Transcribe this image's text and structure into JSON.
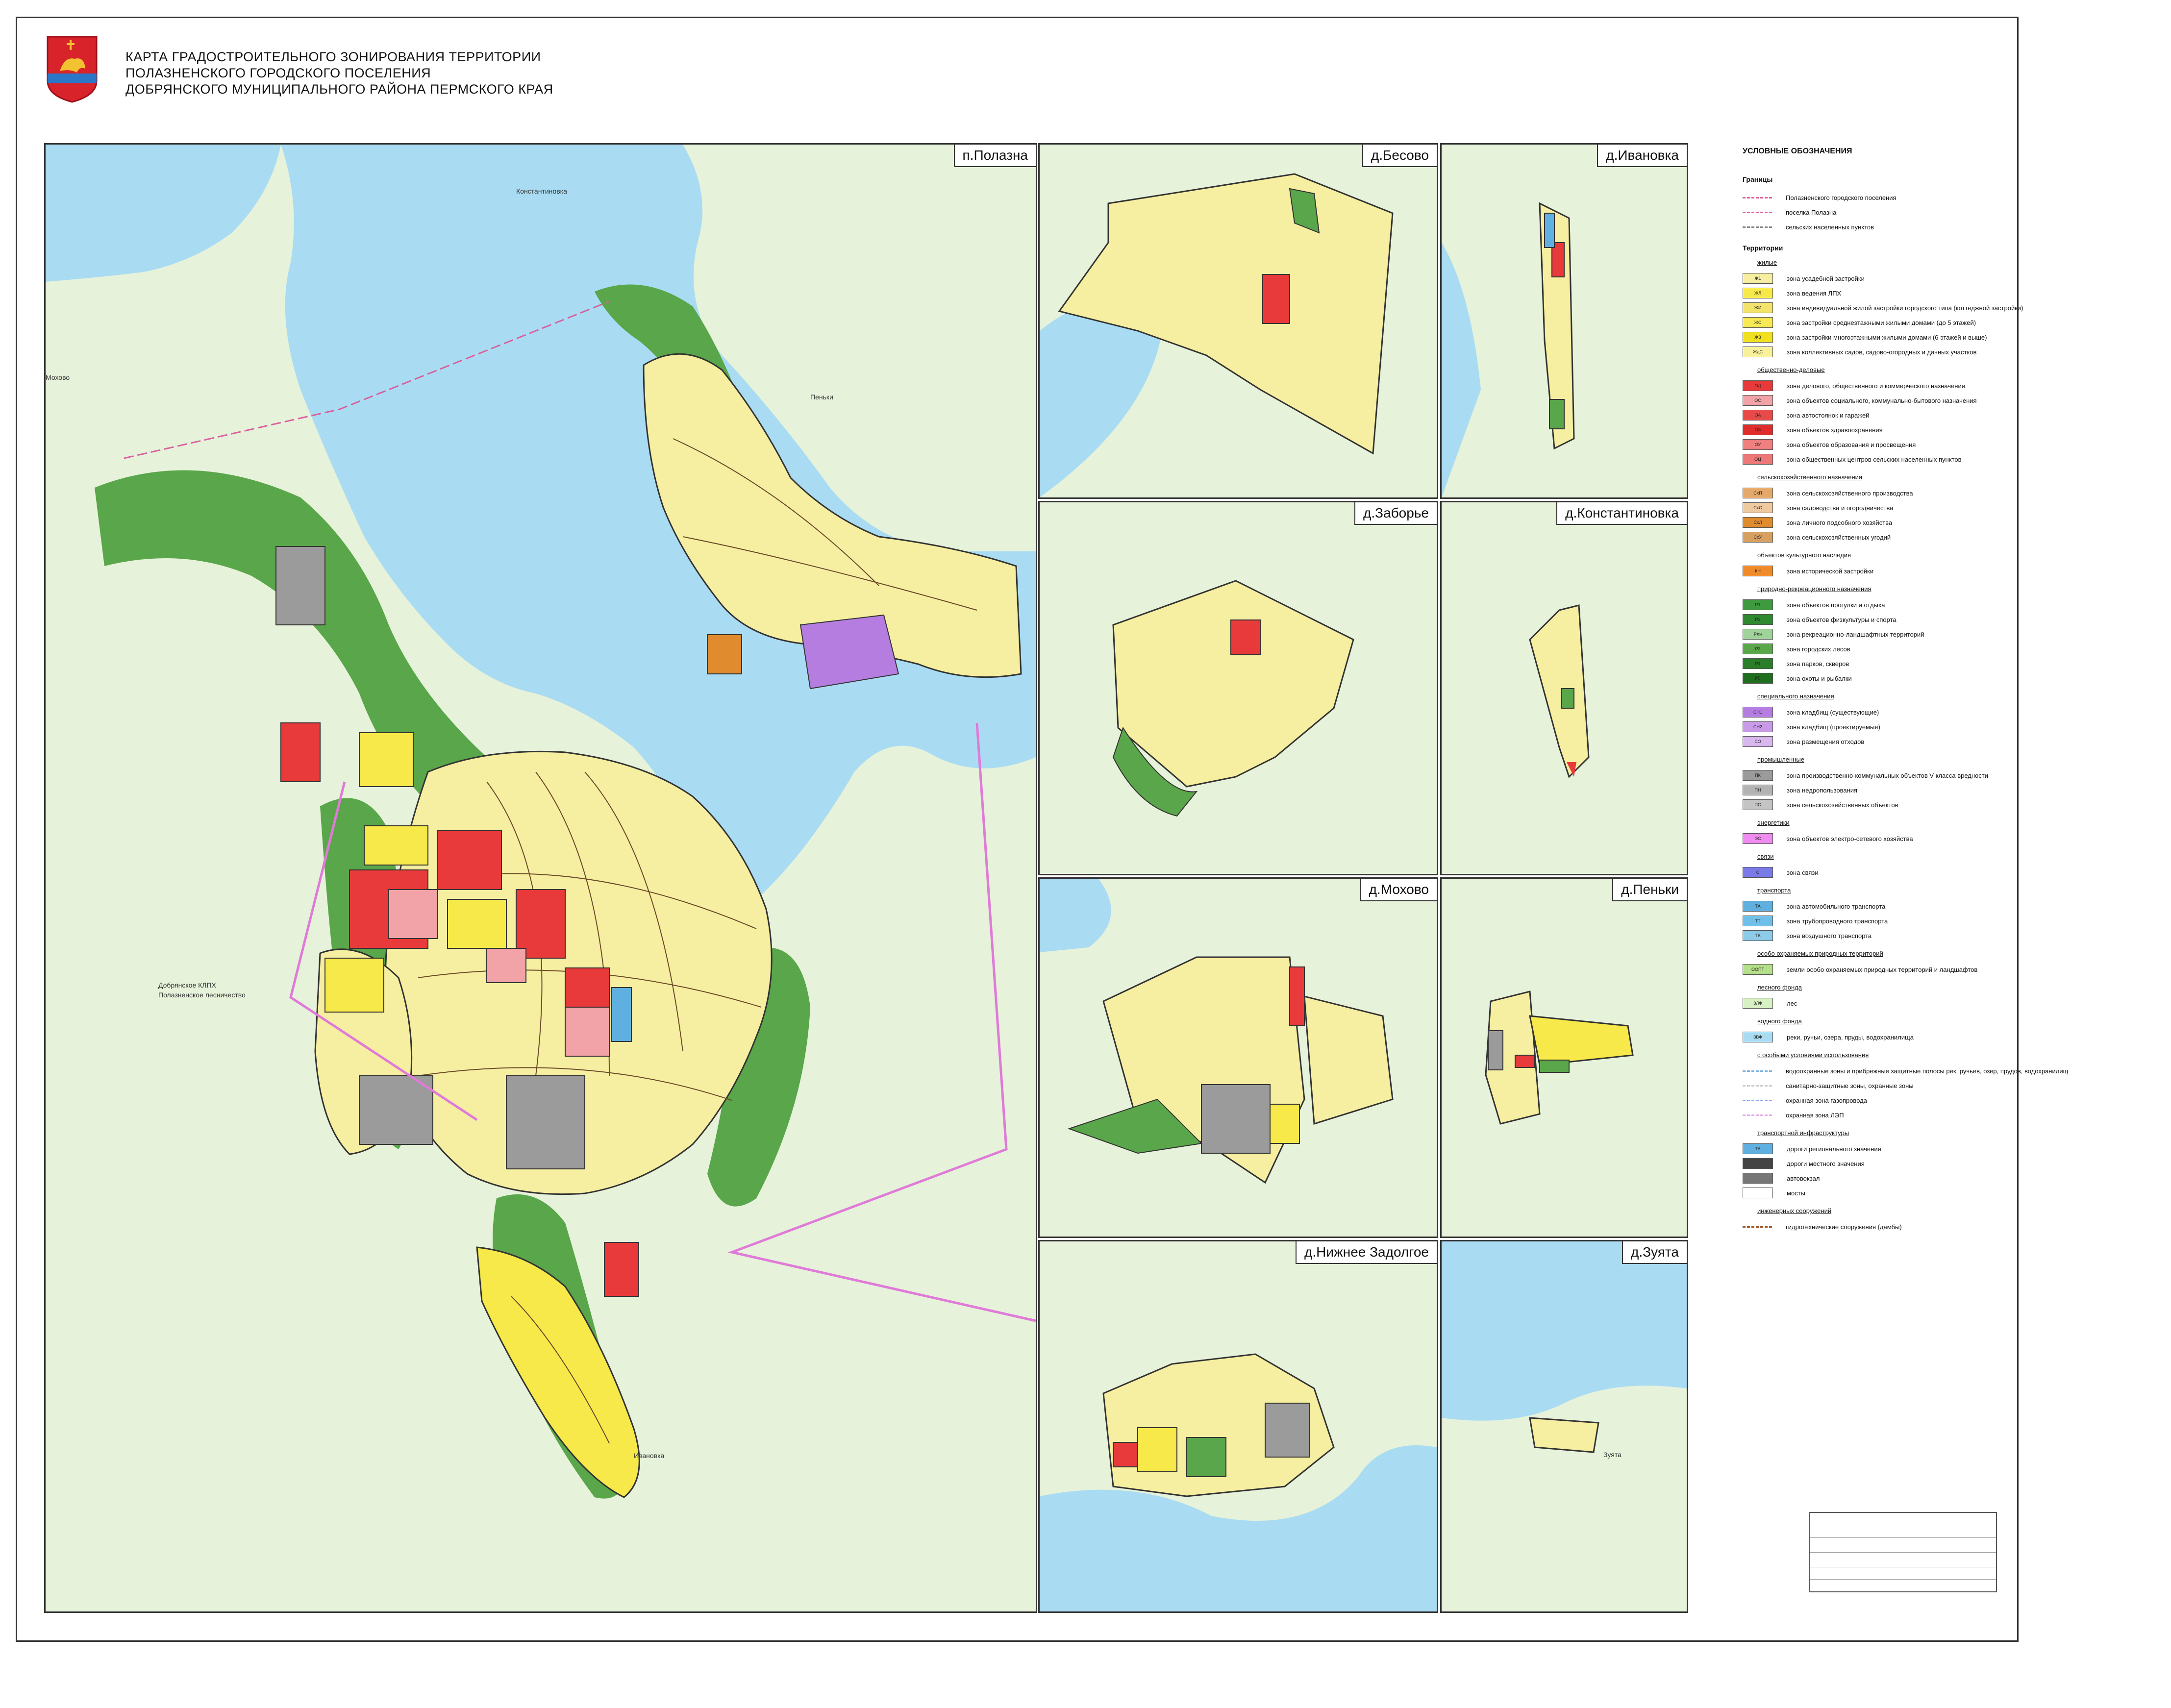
{
  "title": {
    "lines": [
      "КАРТА ГРАДОСТРОИТЕЛЬНОГО ЗОНИРОВАНИЯ ТЕРРИТОРИИ",
      "ПОЛАЗНЕНСКОГО ГОРОДСКОГО ПОСЕЛЕНИЯ",
      "ДОБРЯНСКОГО МУНИЦИПАЛЬНОГО РАЙОНА ПЕРМСКОГО КРАЯ"
    ]
  },
  "panels": {
    "polazna": "п.Полазна",
    "besovo": "д.Бесово",
    "ivanovka": "д.Ивановка",
    "zabore": "д.Заборье",
    "konstantinovka": "д.Константиновка",
    "mokhovo": "д.Мохово",
    "penki": "д.Пеньки",
    "nizhnee_zadolgoe": "д.Нижнее Задолгое",
    "zuyata": "д.Зуята"
  },
  "map_labels": {
    "konstantinovka": "Константиновка",
    "penki": "Пеньки",
    "ivanovka": "Ивановка",
    "mokhovo": "Мохово",
    "zuyata": "Зуята",
    "forestry1": "Добрянское КЛПХ",
    "forestry2": "Полазненское лесничество"
  },
  "colors": {
    "water": "#a9dcf2",
    "land": "#e8f3dc",
    "forest": "#5aa64a",
    "residential": "#f6eea0",
    "residential_lph": "#f7e94a",
    "business": "#e83a3a",
    "social": "#f2a3a8",
    "industrial": "#9b9b9b",
    "cemetery": "#b57de0",
    "transport": "#5fb0e0",
    "agri": "#e08c2e",
    "boundary": "#e07ad8"
  },
  "legend": {
    "title": "УСЛОВНЫЕ ОБОЗНАЧЕНИЯ",
    "boundaries_header": "Границы",
    "boundaries": [
      {
        "label": "Полазненского городского поселения",
        "color": "#d9609e"
      },
      {
        "label": "поселка Полазна",
        "color": "#d9609e"
      },
      {
        "label": "сельских населенных пунктов",
        "color": "#888888"
      }
    ],
    "territories_header": "Территории",
    "groups": [
      {
        "name": "жилые",
        "items": [
          {
            "code": "Ж1",
            "label": "зона усадебной застройки",
            "color": "#f6eea0"
          },
          {
            "code": "ЖЛ",
            "label": "зона ведения ЛПХ",
            "color": "#f7e94a"
          },
          {
            "code": "ЖИ",
            "label": "зона индивидуальной жилой застройки городского типа (коттеджной застройки)",
            "color": "#f3e36a"
          },
          {
            "code": "ЖС",
            "label": "зона застройки среднеэтажными жилыми домами (до 5 этажей)",
            "color": "#f7ea55"
          },
          {
            "code": "ЖЗ",
            "label": "зона застройки многоэтажными жилыми домами (6 этажей и выше)",
            "color": "#f1e01e"
          },
          {
            "code": "ЖдС",
            "label": "зона коллективных садов, садово-огородных и дачных участков",
            "color": "#f8f09a"
          }
        ]
      },
      {
        "name": "общественно-деловые",
        "items": [
          {
            "code": "ОД",
            "label": "зона делового, общественного и коммерческого назначения",
            "color": "#e83a3a"
          },
          {
            "code": "ОС",
            "label": "зона объектов социального, коммунально-бытового назначения",
            "color": "#f2a3a8"
          },
          {
            "code": "ОА",
            "label": "зона автостоянок и гаражей",
            "color": "#e84a4a"
          },
          {
            "code": "ОЗ",
            "label": "зона объектов здравоохранения",
            "color": "#e02c2c"
          },
          {
            "code": "ОУ",
            "label": "зона объектов образования и просвещения",
            "color": "#f08080"
          },
          {
            "code": "ОЦ",
            "label": "зона общественных центров сельских населенных пунктов",
            "color": "#ee7777"
          }
        ]
      },
      {
        "name": "сельскохозяйственного назначения",
        "items": [
          {
            "code": "СхП",
            "label": "зона сельскохозяйственного производства",
            "color": "#e3a86a"
          },
          {
            "code": "СхС",
            "label": "зона садоводства и огородничества",
            "color": "#efc9a0"
          },
          {
            "code": "СхЛ",
            "label": "зона личного подсобного хозяйства",
            "color": "#e08c2e"
          },
          {
            "code": "СхУ",
            "label": "зона сельскохозяйственных угодий",
            "color": "#d7a060"
          }
        ]
      },
      {
        "name": "объектов культурного наследия",
        "items": [
          {
            "code": "КН",
            "label": "зона исторической застройки",
            "color": "#ee8a2a"
          }
        ]
      },
      {
        "name": "природно-рекреационного назначения",
        "items": [
          {
            "code": "Р1",
            "label": "зона объектов прогулки и отдыха",
            "color": "#3f9a3f"
          },
          {
            "code": "Р2",
            "label": "зона объектов физкультуры и спорта",
            "color": "#2f8a2f"
          },
          {
            "code": "Рлн",
            "label": "зона рекреационно-ландшафтных территорий",
            "color": "#9fd39a"
          },
          {
            "code": "Р3",
            "label": "зона городских лесов",
            "color": "#5aa64a"
          },
          {
            "code": "Р4",
            "label": "зона парков, скверов",
            "color": "#2a7e2a"
          },
          {
            "code": "Р5",
            "label": "зона охоты и рыбалки",
            "color": "#1f6e1f"
          }
        ]
      },
      {
        "name": "специального назначения",
        "items": [
          {
            "code": "СН1",
            "label": "зона кладбищ (существующие)",
            "color": "#b57de0"
          },
          {
            "code": "СН2",
            "label": "зона кладбищ (проектируемые)",
            "color": "#c99ae8"
          },
          {
            "code": "СО",
            "label": "зона размещения отходов",
            "color": "#d9b8ef"
          }
        ]
      },
      {
        "name": "промышленные",
        "items": [
          {
            "code": "ПК",
            "label": "зона производственно-коммунальных объектов V класса вредности",
            "color": "#9b9b9b"
          },
          {
            "code": "ПН",
            "label": "зона недропользования",
            "color": "#b3b3b3"
          },
          {
            "code": "ПС",
            "label": "зона сельскохозяйственных объектов",
            "color": "#c4c4c4"
          }
        ]
      },
      {
        "name": "энергетики",
        "items": [
          {
            "code": "ЭС",
            "label": "зона объектов электро-сетевого хозяйства",
            "color": "#f08cf0"
          }
        ]
      },
      {
        "name": "связи",
        "items": [
          {
            "code": "С",
            "label": "зона связи",
            "color": "#7a7ae8"
          }
        ]
      },
      {
        "name": "транспорта",
        "items": [
          {
            "code": "ТА",
            "label": "зона автомобильного транспорта",
            "color": "#5fb0e0"
          },
          {
            "code": "ТТ",
            "label": "зона трубопроводного транспорта",
            "color": "#70bfe8"
          },
          {
            "code": "ТВ",
            "label": "зона воздушного транспорта",
            "color": "#8ecbe8"
          }
        ]
      },
      {
        "name": "особо охраняемых природных территорий",
        "items": [
          {
            "code": "ООПТ",
            "label": "земли особо охраняемых природных территорий и ландшафтов",
            "color": "#b5e08a"
          }
        ]
      },
      {
        "name": "лесного фонда",
        "items": [
          {
            "code": "ЗЛФ",
            "label": "лес",
            "color": "#d7f0c4"
          }
        ]
      },
      {
        "name": "водного фонда",
        "items": [
          {
            "code": "ЗВФ",
            "label": "реки, ручьи, озера, пруды, водохранилища",
            "color": "#a9dcf2"
          }
        ]
      }
    ],
    "special_header": "с особыми условиями использования",
    "special": [
      {
        "label": "водоохранные зоны и прибрежные защитные полосы рек, ручьев, озер, прудов, водохранилищ",
        "color": "#7fb3e0"
      },
      {
        "label": "санитарно-защитные зоны, охранные зоны",
        "color": "#cccccc"
      },
      {
        "label": "охранная зона газопровода",
        "color": "#88a8f0"
      },
      {
        "label": "охранная зона ЛЭП",
        "color": "#e7a7e7"
      }
    ],
    "transport_infra_header": "транспортной инфраструктуры",
    "transport_infra": [
      {
        "code": "ТА",
        "label": "дороги регионального значения",
        "color": "#5fb0e0"
      },
      {
        "code": "",
        "label": "дороги местного значения",
        "color": "#444444"
      },
      {
        "code": "",
        "label": "автовокзал",
        "color": "#777777"
      },
      {
        "code": "",
        "label": "мосты",
        "color": "#ffffff"
      }
    ],
    "engineering_header": "инженерных сооружений",
    "engineering": [
      {
        "label": "гидротехнические сооружения (дамбы)",
        "color": "#a05a2c"
      }
    ]
  }
}
